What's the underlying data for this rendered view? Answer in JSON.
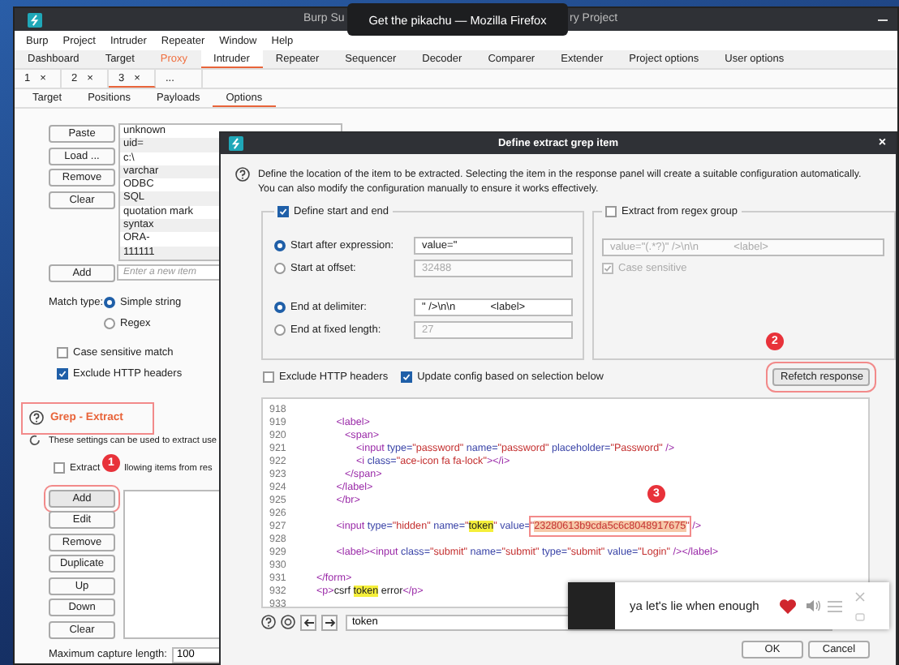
{
  "tooltip": {
    "text": "Get the pikachu — Mozilla Firefox"
  },
  "burp": {
    "title_parts": [
      "Burp Su",
      "ry Project"
    ],
    "menu": [
      "Burp",
      "Project",
      "Intruder",
      "Repeater",
      "Window",
      "Help"
    ],
    "tabs": [
      {
        "label": "Dashboard",
        "selected": false,
        "alert": false
      },
      {
        "label": "Target",
        "selected": false,
        "alert": false
      },
      {
        "label": "Proxy",
        "selected": false,
        "alert": true
      },
      {
        "label": "Intruder",
        "selected": true,
        "alert": false
      },
      {
        "label": "Repeater",
        "selected": false,
        "alert": false
      },
      {
        "label": "Sequencer",
        "selected": false,
        "alert": false
      },
      {
        "label": "Decoder",
        "selected": false,
        "alert": false
      },
      {
        "label": "Comparer",
        "selected": false,
        "alert": false
      },
      {
        "label": "Extender",
        "selected": false,
        "alert": false
      },
      {
        "label": "Project options",
        "selected": false,
        "alert": false
      },
      {
        "label": "User options",
        "selected": false,
        "alert": false
      }
    ],
    "attack_tabs": [
      {
        "label": "1",
        "close": "×",
        "selected": false
      },
      {
        "label": "2",
        "close": "×",
        "selected": false
      },
      {
        "label": "3",
        "close": "×",
        "selected": true
      },
      {
        "label": "...",
        "selected": false
      }
    ],
    "option_tabs": [
      {
        "label": "Target",
        "selected": false
      },
      {
        "label": "Positions",
        "selected": false
      },
      {
        "label": "Payloads",
        "selected": false
      },
      {
        "label": "Options",
        "selected": true
      }
    ],
    "grep_match": {
      "buttons": [
        "Paste",
        "Load ...",
        "Remove",
        "Clear"
      ],
      "items": [
        "unknown",
        "uid=",
        "c:\\",
        "varchar",
        "ODBC",
        "SQL",
        "quotation mark",
        "syntax",
        "ORA-",
        "111111"
      ],
      "add_button": "Add",
      "new_item": {
        "placeholder": "Enter a new item"
      },
      "match_type_label": "Match type:",
      "match_types": [
        {
          "label": "Simple string",
          "selected": true
        },
        {
          "label": "Regex",
          "selected": false
        }
      ],
      "options": [
        {
          "label": "Case sensitive match",
          "checked": false
        },
        {
          "label": "Exclude HTTP headers",
          "checked": true
        }
      ]
    },
    "grep_extract": {
      "heading": "Grep - Extract",
      "marked": true,
      "description": "These settings can be used to extract use",
      "extract_option": {
        "checked": false,
        "label_parts": [
          "Extract",
          "llowing items from res"
        ]
      },
      "buttons": [
        {
          "label": "Add",
          "marked": true
        },
        {
          "label": "Edit",
          "marked": false
        },
        {
          "label": "Remove",
          "marked": false
        },
        {
          "label": "Duplicate",
          "marked": false
        },
        {
          "label": "Up",
          "marked": false
        },
        {
          "label": "Down",
          "marked": false
        },
        {
          "label": "Clear",
          "marked": false
        }
      ],
      "max_capture": {
        "label": "Maximum capture length:",
        "value": "100"
      }
    }
  },
  "dialog": {
    "title": "Define extract grep item",
    "close": "×",
    "help": "Define the location of the item to be extracted. Selecting the item in the response panel will create a suitable configuration automatically. You can also modify the configuration manually to ensure it works effectively.",
    "start_end": {
      "label": "Define start and end",
      "checked": true,
      "start_options": [
        {
          "label": "Start after expression:",
          "selected": true,
          "value": "value=\""
        },
        {
          "label": "Start at offset:",
          "selected": false,
          "value": "32488"
        }
      ],
      "end_options": [
        {
          "label": "End at delimiter:",
          "selected": true,
          "value": "\" />\\n\\n            <label>"
        },
        {
          "label": "End at fixed length:",
          "selected": false,
          "value": "27"
        }
      ]
    },
    "regex": {
      "label": "Extract from regex group",
      "checked": false,
      "value": "value=\"(.*?)\" />\\n\\n            <label>",
      "case_sensitive": {
        "label": "Case sensitive",
        "checked": true
      }
    },
    "exclude_headers": {
      "label": "Exclude HTTP headers",
      "checked": false
    },
    "update_config": {
      "label": "Update config based on selection below",
      "checked": true
    },
    "refetch": {
      "label": "Refetch response",
      "marked": true
    },
    "code_lines": [
      {
        "num": "918"
      },
      {
        "num": "919",
        "parts": [
          {
            "kind": "tag",
            "text": "               <label>"
          }
        ]
      },
      {
        "num": "920",
        "parts": [
          {
            "kind": "tag",
            "text": "                  <span>"
          }
        ]
      },
      {
        "num": "921",
        "parts": [
          {
            "kind": "tag",
            "text": "                      <input "
          },
          {
            "kind": "attr",
            "text": "type="
          },
          {
            "kind": "value",
            "text": "\"password\" "
          },
          {
            "kind": "attr",
            "text": "name="
          },
          {
            "kind": "value",
            "text": "\"password\" "
          },
          {
            "kind": "attr",
            "text": "placeholder="
          },
          {
            "kind": "value",
            "text": "\"Password\""
          },
          {
            "kind": "tag",
            "text": " />"
          }
        ]
      },
      {
        "num": "922",
        "parts": [
          {
            "kind": "tag",
            "text": "                      <i "
          },
          {
            "kind": "attr",
            "text": "class="
          },
          {
            "kind": "value",
            "text": "\"ace-icon fa fa-lock\""
          },
          {
            "kind": "tag",
            "text": "></i>"
          }
        ]
      },
      {
        "num": "923",
        "parts": [
          {
            "kind": "tag",
            "text": "                  </span>"
          }
        ]
      },
      {
        "num": "924",
        "parts": [
          {
            "kind": "tag",
            "text": "               </label>"
          }
        ]
      },
      {
        "num": "925",
        "parts": [
          {
            "kind": "tag",
            "text": "               </br>"
          }
        ]
      },
      {
        "num": "926"
      },
      {
        "num": "927",
        "parts": [
          {
            "kind": "tag",
            "text": "               <input "
          },
          {
            "kind": "attr",
            "text": "type="
          },
          {
            "kind": "value",
            "text": "\"hidden\" "
          },
          {
            "kind": "attr",
            "text": "name="
          },
          {
            "kind": "value",
            "text": "\""
          },
          {
            "kind": "match",
            "text": "token"
          },
          {
            "kind": "value",
            "text": "\" "
          },
          {
            "kind": "attr",
            "text": "value="
          },
          {
            "kind": "value",
            "text": "\""
          },
          {
            "kind": "selection",
            "text": "23280613b9cda5c6c8048917675",
            "marked": true
          },
          {
            "kind": "value",
            "text": "\""
          },
          {
            "kind": "tag",
            "text": " />"
          }
        ]
      },
      {
        "num": "928"
      },
      {
        "num": "929",
        "parts": [
          {
            "kind": "tag",
            "text": "               <label><input "
          },
          {
            "kind": "attr",
            "text": "class="
          },
          {
            "kind": "value",
            "text": "\"submit\" "
          },
          {
            "kind": "attr",
            "text": "name="
          },
          {
            "kind": "value",
            "text": "\"submit\" "
          },
          {
            "kind": "attr",
            "text": "type="
          },
          {
            "kind": "value",
            "text": "\"submit\" "
          },
          {
            "kind": "attr",
            "text": "value="
          },
          {
            "kind": "value",
            "text": "\"Login\""
          },
          {
            "kind": "tag",
            "text": " /></label>"
          }
        ]
      },
      {
        "num": "930"
      },
      {
        "num": "931",
        "parts": [
          {
            "kind": "tag",
            "text": "        </form>"
          }
        ]
      },
      {
        "num": "932",
        "parts": [
          {
            "kind": "tag",
            "text": "        <p>"
          },
          {
            "kind": "plain",
            "text": "csrf "
          },
          {
            "kind": "match",
            "text": "token"
          },
          {
            "kind": "plain",
            "text": " error"
          },
          {
            "kind": "tag",
            "text": "</p>"
          }
        ]
      },
      {
        "num": "933"
      }
    ],
    "search": {
      "value": "token"
    },
    "buttons": [
      "OK",
      "Cancel"
    ]
  },
  "notification": {
    "text": "ya let's lie when enough",
    "liked": true
  },
  "badges": [
    "1",
    "2",
    "3"
  ]
}
